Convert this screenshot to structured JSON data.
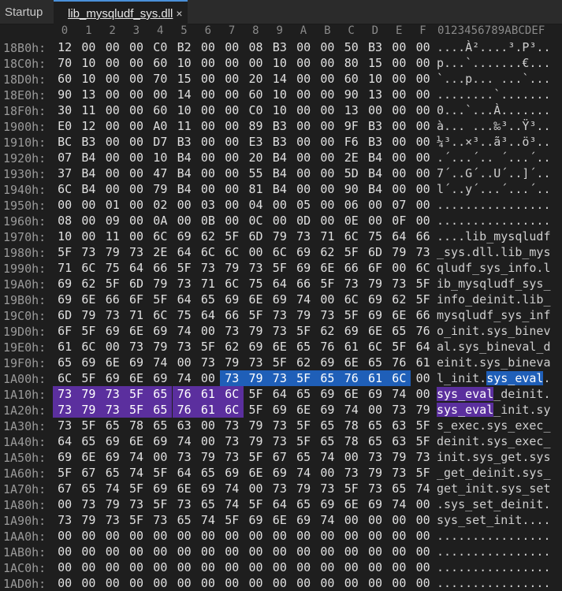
{
  "tabs": [
    {
      "label": "Startup",
      "active": false
    },
    {
      "label": "lib_mysqludf_sys.dll",
      "active": true,
      "close": "×"
    }
  ],
  "columns": [
    "0",
    "1",
    "2",
    "3",
    "4",
    "5",
    "6",
    "7",
    "8",
    "9",
    "A",
    "B",
    "C",
    "D",
    "E",
    "F"
  ],
  "ascii_header": "0123456789ABCDEF",
  "rows": [
    {
      "offset": "18B0h:",
      "bytes": [
        "12",
        "00",
        "00",
        "00",
        "C0",
        "B2",
        "00",
        "00",
        "08",
        "B3",
        "00",
        "00",
        "50",
        "B3",
        "00",
        "00"
      ],
      "ascii": "....À²....³.P³.."
    },
    {
      "offset": "18C0h:",
      "bytes": [
        "70",
        "10",
        "00",
        "00",
        "60",
        "10",
        "00",
        "00",
        "00",
        "10",
        "00",
        "00",
        "80",
        "15",
        "00",
        "00"
      ],
      "ascii": "p...`.......€..."
    },
    {
      "offset": "18D0h:",
      "bytes": [
        "60",
        "10",
        "00",
        "00",
        "70",
        "15",
        "00",
        "00",
        "20",
        "14",
        "00",
        "00",
        "60",
        "10",
        "00",
        "00"
      ],
      "ascii": "`...p... ...`..."
    },
    {
      "offset": "18E0h:",
      "bytes": [
        "90",
        "13",
        "00",
        "00",
        "00",
        "14",
        "00",
        "00",
        "60",
        "10",
        "00",
        "00",
        "90",
        "13",
        "00",
        "00"
      ],
      "ascii": "........`......."
    },
    {
      "offset": "18F0h:",
      "bytes": [
        "30",
        "11",
        "00",
        "00",
        "60",
        "10",
        "00",
        "00",
        "C0",
        "10",
        "00",
        "00",
        "13",
        "00",
        "00",
        "00"
      ],
      "ascii": "0...`...À......."
    },
    {
      "offset": "1900h:",
      "bytes": [
        "E0",
        "12",
        "00",
        "00",
        "A0",
        "11",
        "00",
        "00",
        "89",
        "B3",
        "00",
        "00",
        "9F",
        "B3",
        "00",
        "00"
      ],
      "ascii": "à... ...‰³..Ÿ³.."
    },
    {
      "offset": "1910h:",
      "bytes": [
        "BC",
        "B3",
        "00",
        "00",
        "D7",
        "B3",
        "00",
        "00",
        "E3",
        "B3",
        "00",
        "00",
        "F6",
        "B3",
        "00",
        "00"
      ],
      "ascii": "¼³..×³..ã³..ö³.."
    },
    {
      "offset": "1920h:",
      "bytes": [
        "07",
        "B4",
        "00",
        "00",
        "10",
        "B4",
        "00",
        "00",
        "20",
        "B4",
        "00",
        "00",
        "2E",
        "B4",
        "00",
        "00"
      ],
      "ascii": ".´...´.. ´...´.."
    },
    {
      "offset": "1930h:",
      "bytes": [
        "37",
        "B4",
        "00",
        "00",
        "47",
        "B4",
        "00",
        "00",
        "55",
        "B4",
        "00",
        "00",
        "5D",
        "B4",
        "00",
        "00"
      ],
      "ascii": "7´..G´..U´..]´.."
    },
    {
      "offset": "1940h:",
      "bytes": [
        "6C",
        "B4",
        "00",
        "00",
        "79",
        "B4",
        "00",
        "00",
        "81",
        "B4",
        "00",
        "00",
        "90",
        "B4",
        "00",
        "00"
      ],
      "ascii": "l´..y´...´...´.."
    },
    {
      "offset": "1950h:",
      "bytes": [
        "00",
        "00",
        "01",
        "00",
        "02",
        "00",
        "03",
        "00",
        "04",
        "00",
        "05",
        "00",
        "06",
        "00",
        "07",
        "00"
      ],
      "ascii": "................"
    },
    {
      "offset": "1960h:",
      "bytes": [
        "08",
        "00",
        "09",
        "00",
        "0A",
        "00",
        "0B",
        "00",
        "0C",
        "00",
        "0D",
        "00",
        "0E",
        "00",
        "0F",
        "00"
      ],
      "ascii": "................"
    },
    {
      "offset": "1970h:",
      "bytes": [
        "10",
        "00",
        "11",
        "00",
        "6C",
        "69",
        "62",
        "5F",
        "6D",
        "79",
        "73",
        "71",
        "6C",
        "75",
        "64",
        "66"
      ],
      "ascii": "....lib_mysqludf"
    },
    {
      "offset": "1980h:",
      "bytes": [
        "5F",
        "73",
        "79",
        "73",
        "2E",
        "64",
        "6C",
        "6C",
        "00",
        "6C",
        "69",
        "62",
        "5F",
        "6D",
        "79",
        "73"
      ],
      "ascii": "_sys.dll.lib_mys"
    },
    {
      "offset": "1990h:",
      "bytes": [
        "71",
        "6C",
        "75",
        "64",
        "66",
        "5F",
        "73",
        "79",
        "73",
        "5F",
        "69",
        "6E",
        "66",
        "6F",
        "00",
        "6C"
      ],
      "ascii": "qludf_sys_info.l"
    },
    {
      "offset": "19A0h:",
      "bytes": [
        "69",
        "62",
        "5F",
        "6D",
        "79",
        "73",
        "71",
        "6C",
        "75",
        "64",
        "66",
        "5F",
        "73",
        "79",
        "73",
        "5F"
      ],
      "ascii": "ib_mysqludf_sys_"
    },
    {
      "offset": "19B0h:",
      "bytes": [
        "69",
        "6E",
        "66",
        "6F",
        "5F",
        "64",
        "65",
        "69",
        "6E",
        "69",
        "74",
        "00",
        "6C",
        "69",
        "62",
        "5F"
      ],
      "ascii": "info_deinit.lib_"
    },
    {
      "offset": "19C0h:",
      "bytes": [
        "6D",
        "79",
        "73",
        "71",
        "6C",
        "75",
        "64",
        "66",
        "5F",
        "73",
        "79",
        "73",
        "5F",
        "69",
        "6E",
        "66"
      ],
      "ascii": "mysqludf_sys_inf"
    },
    {
      "offset": "19D0h:",
      "bytes": [
        "6F",
        "5F",
        "69",
        "6E",
        "69",
        "74",
        "00",
        "73",
        "79",
        "73",
        "5F",
        "62",
        "69",
        "6E",
        "65",
        "76"
      ],
      "ascii": "o_init.sys_binev"
    },
    {
      "offset": "19E0h:",
      "bytes": [
        "61",
        "6C",
        "00",
        "73",
        "79",
        "73",
        "5F",
        "62",
        "69",
        "6E",
        "65",
        "76",
        "61",
        "6C",
        "5F",
        "64"
      ],
      "ascii": "al.sys_bineval_d"
    },
    {
      "offset": "19F0h:",
      "bytes": [
        "65",
        "69",
        "6E",
        "69",
        "74",
        "00",
        "73",
        "79",
        "73",
        "5F",
        "62",
        "69",
        "6E",
        "65",
        "76",
        "61"
      ],
      "ascii": "einit.sys_bineva"
    },
    {
      "offset": "1A00h:",
      "bytes": [
        "6C",
        "5F",
        "69",
        "6E",
        "69",
        "74",
        "00",
        "73",
        "79",
        "73",
        "5F",
        "65",
        "76",
        "61",
        "6C",
        "00"
      ],
      "ascii": "l_init.sys_eval.",
      "hl": "blue-tail"
    },
    {
      "offset": "1A10h:",
      "bytes": [
        "73",
        "79",
        "73",
        "5F",
        "65",
        "76",
        "61",
        "6C",
        "5F",
        "64",
        "65",
        "69",
        "6E",
        "69",
        "74",
        "00"
      ],
      "ascii": "sys_eval_deinit.",
      "hl": "purple-head"
    },
    {
      "offset": "1A20h:",
      "bytes": [
        "73",
        "79",
        "73",
        "5F",
        "65",
        "76",
        "61",
        "6C",
        "5F",
        "69",
        "6E",
        "69",
        "74",
        "00",
        "73",
        "79"
      ],
      "ascii": "sys_eval_init.sy",
      "hl": "purple-head"
    },
    {
      "offset": "1A30h:",
      "bytes": [
        "73",
        "5F",
        "65",
        "78",
        "65",
        "63",
        "00",
        "73",
        "79",
        "73",
        "5F",
        "65",
        "78",
        "65",
        "63",
        "5F"
      ],
      "ascii": "s_exec.sys_exec_"
    },
    {
      "offset": "1A40h:",
      "bytes": [
        "64",
        "65",
        "69",
        "6E",
        "69",
        "74",
        "00",
        "73",
        "79",
        "73",
        "5F",
        "65",
        "78",
        "65",
        "63",
        "5F"
      ],
      "ascii": "deinit.sys_exec_"
    },
    {
      "offset": "1A50h:",
      "bytes": [
        "69",
        "6E",
        "69",
        "74",
        "00",
        "73",
        "79",
        "73",
        "5F",
        "67",
        "65",
        "74",
        "00",
        "73",
        "79",
        "73"
      ],
      "ascii": "init.sys_get.sys"
    },
    {
      "offset": "1A60h:",
      "bytes": [
        "5F",
        "67",
        "65",
        "74",
        "5F",
        "64",
        "65",
        "69",
        "6E",
        "69",
        "74",
        "00",
        "73",
        "79",
        "73",
        "5F"
      ],
      "ascii": "_get_deinit.sys_"
    },
    {
      "offset": "1A70h:",
      "bytes": [
        "67",
        "65",
        "74",
        "5F",
        "69",
        "6E",
        "69",
        "74",
        "00",
        "73",
        "79",
        "73",
        "5F",
        "73",
        "65",
        "74"
      ],
      "ascii": "get_init.sys_set"
    },
    {
      "offset": "1A80h:",
      "bytes": [
        "00",
        "73",
        "79",
        "73",
        "5F",
        "73",
        "65",
        "74",
        "5F",
        "64",
        "65",
        "69",
        "6E",
        "69",
        "74",
        "00"
      ],
      "ascii": ".sys_set_deinit."
    },
    {
      "offset": "1A90h:",
      "bytes": [
        "73",
        "79",
        "73",
        "5F",
        "73",
        "65",
        "74",
        "5F",
        "69",
        "6E",
        "69",
        "74",
        "00",
        "00",
        "00",
        "00"
      ],
      "ascii": "sys_set_init...."
    },
    {
      "offset": "1AA0h:",
      "bytes": [
        "00",
        "00",
        "00",
        "00",
        "00",
        "00",
        "00",
        "00",
        "00",
        "00",
        "00",
        "00",
        "00",
        "00",
        "00",
        "00"
      ],
      "ascii": "................"
    },
    {
      "offset": "1AB0h:",
      "bytes": [
        "00",
        "00",
        "00",
        "00",
        "00",
        "00",
        "00",
        "00",
        "00",
        "00",
        "00",
        "00",
        "00",
        "00",
        "00",
        "00"
      ],
      "ascii": "................"
    },
    {
      "offset": "1AC0h:",
      "bytes": [
        "00",
        "00",
        "00",
        "00",
        "00",
        "00",
        "00",
        "00",
        "00",
        "00",
        "00",
        "00",
        "00",
        "00",
        "00",
        "00"
      ],
      "ascii": "................"
    },
    {
      "offset": "1AD0h:",
      "bytes": [
        "00",
        "00",
        "00",
        "00",
        "00",
        "00",
        "00",
        "00",
        "00",
        "00",
        "00",
        "00",
        "00",
        "00",
        "00",
        "00"
      ],
      "ascii": "................"
    }
  ],
  "colors": {
    "selection_blue": "#1f5fb8",
    "selection_purple": "#5b2f9e",
    "background": "#1e1e1e"
  }
}
